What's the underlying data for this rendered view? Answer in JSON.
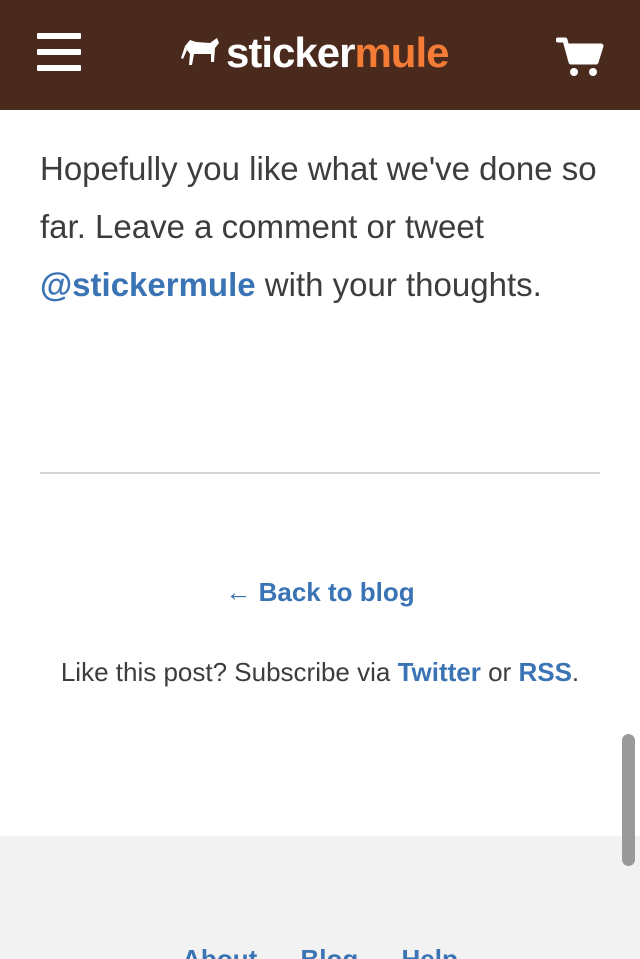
{
  "header": {
    "logo_sticker": "sticker",
    "logo_mule": "mule",
    "menu_icon": "hamburger-menu-icon",
    "cart_icon": "shopping-cart-icon",
    "background_color": "#4b2a1e",
    "accent_color": "#f47c36"
  },
  "article": {
    "text_before": "Hopefully you like what we've done so far. Leave a comment or tweet ",
    "mention": "@stickermule",
    "text_after": " with your thoughts."
  },
  "navigation": {
    "back_arrow": "←",
    "back_label": "Back to blog"
  },
  "subscribe": {
    "text_before": "Like this post? Subscribe via ",
    "twitter_label": "Twitter",
    "or_text": " or ",
    "rss_label": "RSS",
    "period": "."
  },
  "footer": {
    "links": [
      "About",
      "Blog",
      "Help"
    ]
  },
  "link_color": "#3a74b5"
}
